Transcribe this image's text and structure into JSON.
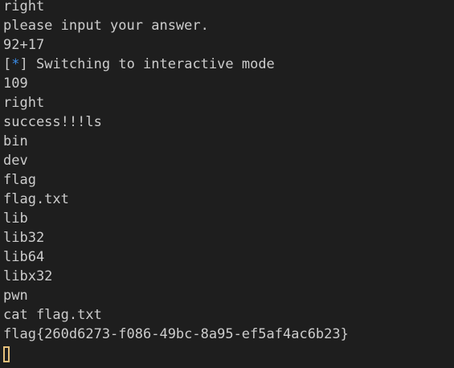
{
  "terminal": {
    "lines": [
      "right",
      "please input your answer.",
      "92+17",
      "[*] Switching to interactive mode",
      "109",
      "right",
      "success!!!ls",
      "bin",
      "dev",
      "flag",
      "flag.txt",
      "lib",
      "lib32",
      "lib64",
      "libx32",
      "pwn",
      "cat flag.txt",
      "flag{260d6273-f086-49bc-8a95-ef5af4ac6b23}"
    ],
    "status_prefix": {
      "open": "[",
      "star": "*",
      "close": "]",
      "text": " Switching to interactive mode"
    },
    "colors": {
      "background": "#1e1e1e",
      "foreground": "#cccccc",
      "info_star": "#3b8eea",
      "cursor": "#e5c07b"
    }
  }
}
